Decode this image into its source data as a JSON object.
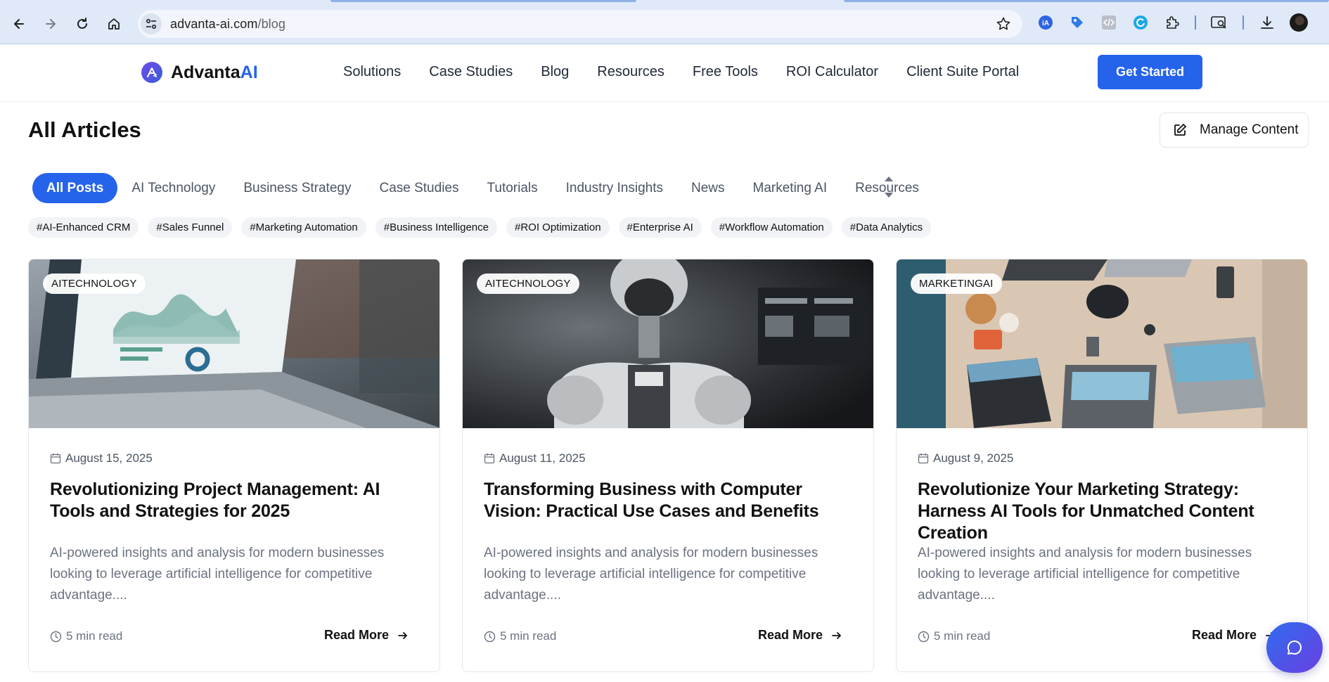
{
  "browser": {
    "url_host": "advanta-ai.com",
    "url_path": "/blog"
  },
  "site": {
    "brand_primary": "Advanta",
    "brand_accent": "AI",
    "accent_color": "#2563eb",
    "nav": [
      "Solutions",
      "Case Studies",
      "Blog",
      "Resources",
      "Free Tools",
      "ROI Calculator",
      "Client Suite Portal"
    ],
    "cta_label": "Get Started"
  },
  "main": {
    "title": "All Articles",
    "manage_label": "Manage Content",
    "categories": [
      "All Posts",
      "AI Technology",
      "Business Strategy",
      "Case Studies",
      "Tutorials",
      "Industry Insights",
      "News",
      "Marketing AI",
      "Resources"
    ],
    "active_category": "All Posts",
    "tags": [
      "#AI-Enhanced CRM",
      "#Sales Funnel",
      "#Marketing Automation",
      "#Business Intelligence",
      "#ROI Optimization",
      "#Enterprise AI",
      "#Workflow Automation",
      "#Data Analytics"
    ]
  },
  "articles": [
    {
      "badge": "AITECHNOLOGY",
      "image_icon": "laptop-analytics-image",
      "date": "August 15, 2025",
      "title": "Revolutionizing Project Management: AI Tools and Strategies for 2025",
      "excerpt": "AI-powered insights and analysis for modern businesses looking to leverage artificial intelligence for competitive advantage....",
      "read_time": "5 min read",
      "more_label": "Read More"
    },
    {
      "badge": "AITECHNOLOGY",
      "image_icon": "robot-image",
      "date": "August 11, 2025",
      "title": "Transforming Business with Computer Vision: Practical Use Cases and Benefits",
      "excerpt": "AI-powered insights and analysis for modern businesses looking to leverage artificial intelligence for competitive advantage....",
      "read_time": "5 min read",
      "more_label": "Read More"
    },
    {
      "badge": "MARKETINGAI",
      "image_icon": "team-desk-image",
      "date": "August 9, 2025",
      "title": "Revolutionize Your Marketing Strategy: Harness AI Tools for Unmatched Content Creation",
      "excerpt": "AI-powered insights and analysis for modern businesses looking to leverage artificial intelligence for competitive advantage....",
      "read_time": "5 min read",
      "more_label": "Read More"
    }
  ]
}
